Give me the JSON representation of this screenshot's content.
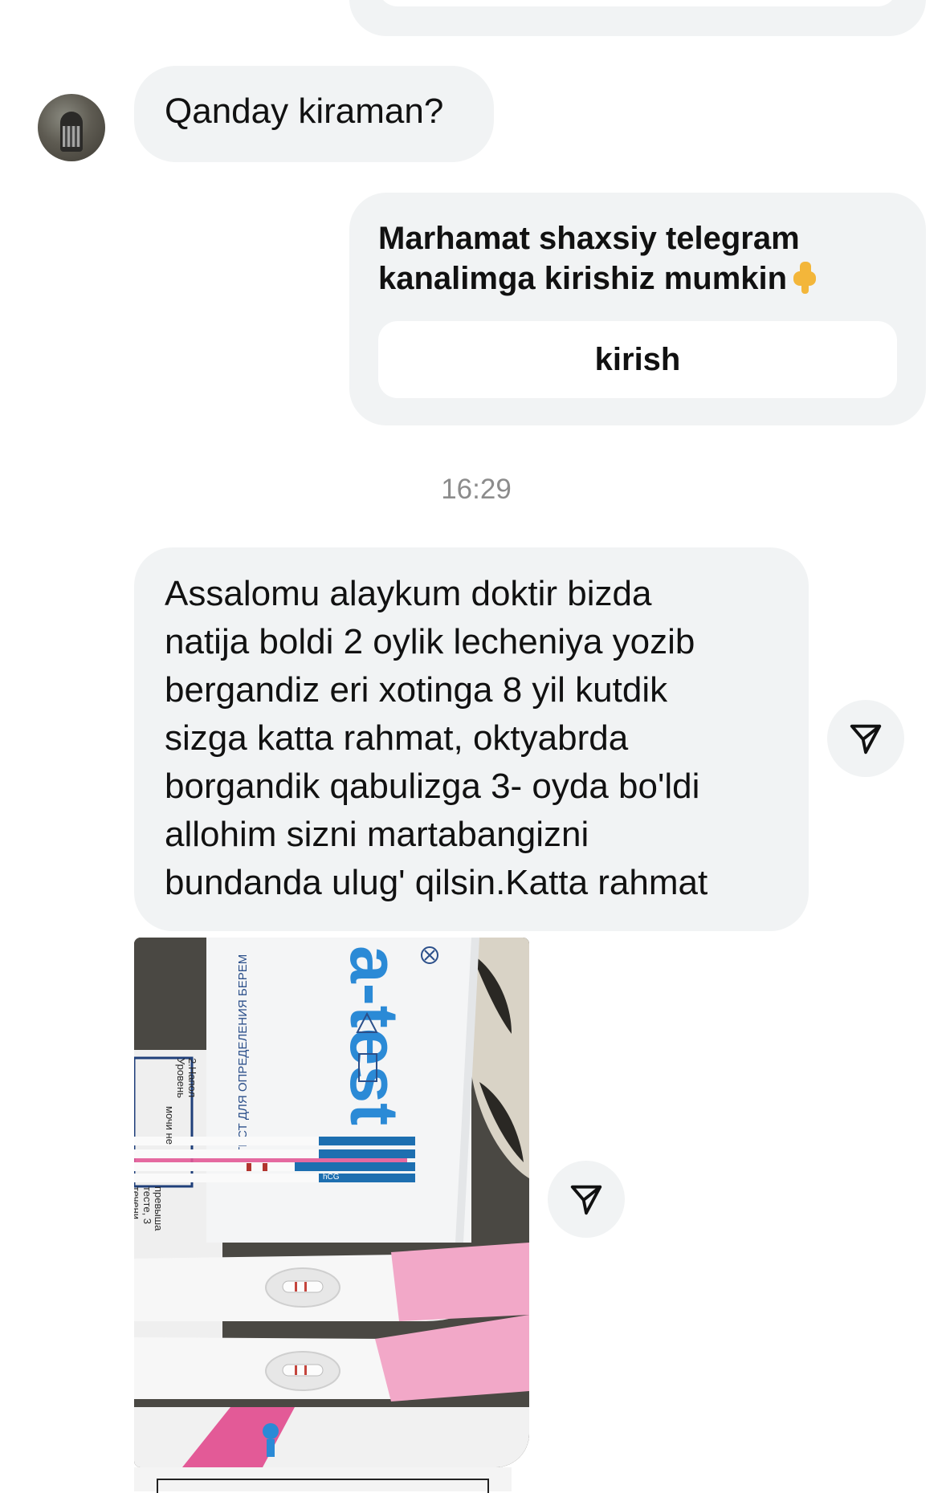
{
  "chat": {
    "question": "Qanday kiraman?",
    "reply": {
      "line1": "Marhamat shaxsiy telegram",
      "line2": "kanalimga kirishiz mumkin",
      "emoji": "point-down-emoji",
      "button_label": "kirish"
    },
    "timestamp": "16:29",
    "long_message": {
      "lines": [
        "Assalomu alaykum doktir bizda",
        "natija boldi 2 oylik lecheniya yozib",
        "bergandiz eri xotinga 8 yil kutdik",
        "sizga katta rahmat, oktyabrda",
        "borgandik qabulizga 3- oyda bo'ldi",
        "allohim sizni martabangizni",
        "bundanda ulug' qilsin.Katta rahmat"
      ]
    },
    "photo": {
      "package_brand": "a-test",
      "package_caption": "ТЕСТ ДЛЯ ОПРЕДЕЛЕНИЯ БЕРЕМ",
      "strip_label": "hCG",
      "leaflet_text": [
        "2.Напол",
        "Уровень",
        "мочи не",
        "превыша",
        "тесте, 3",
        "течени"
      ]
    }
  },
  "icons": {
    "share": "share-icon",
    "avatar": "avatar-icon"
  },
  "colors": {
    "bubble": "#f1f3f4",
    "timestamp": "#8c8c8c",
    "text": "#111111",
    "brand_blue": "#2b8ad6",
    "brand_pink": "#e35a97"
  }
}
